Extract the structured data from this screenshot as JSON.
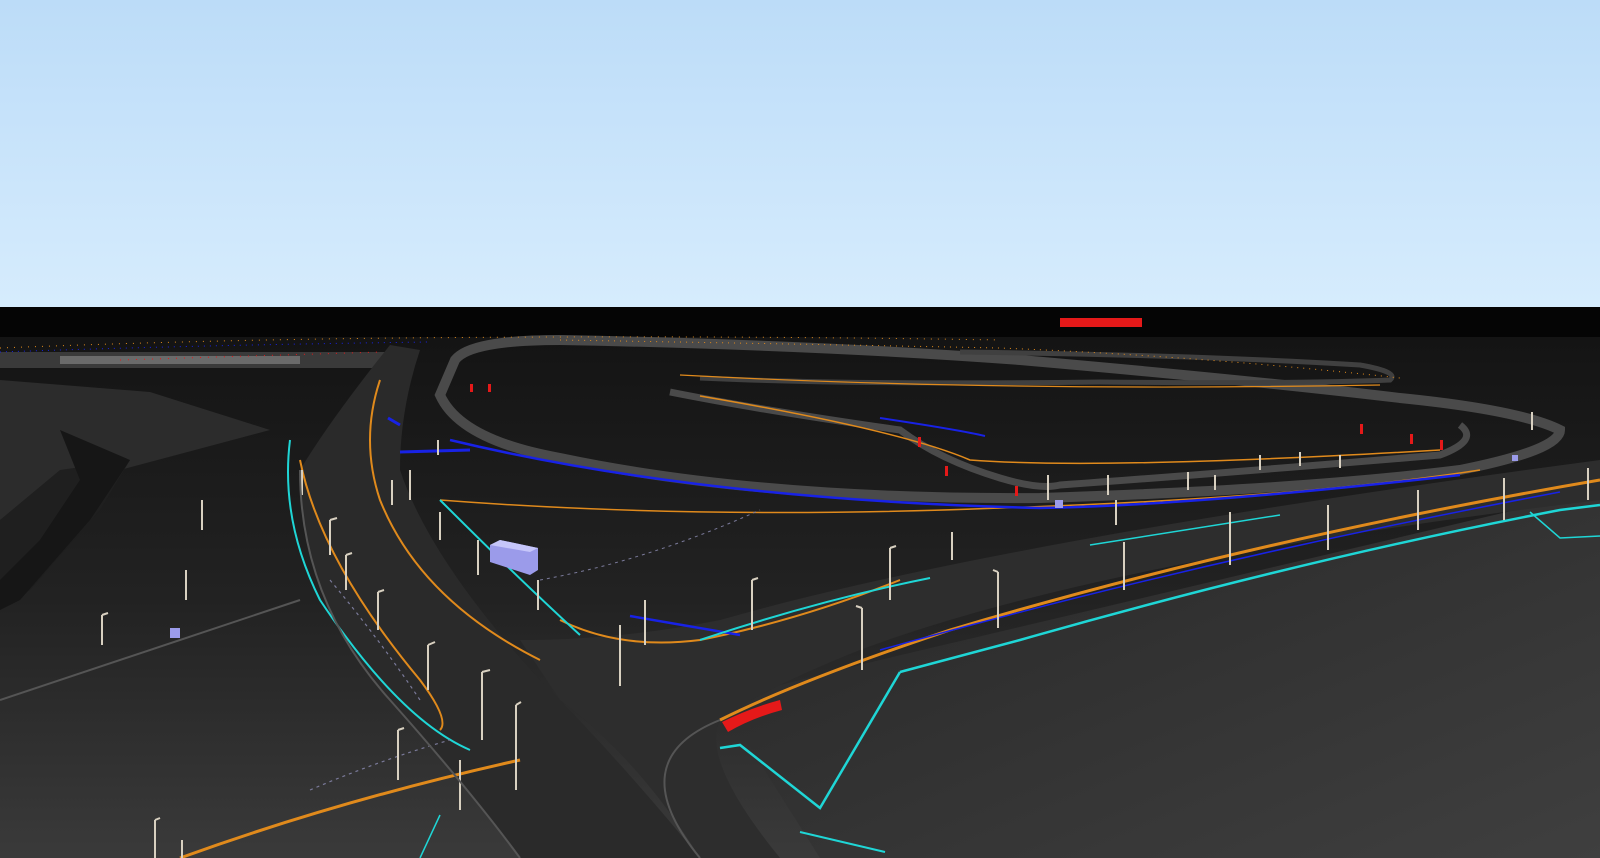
{
  "viewport": {
    "type": "3d-scene-render",
    "scene": "road-network-wireframe",
    "labels": []
  },
  "colors": {
    "sky_top": "#bcdcf8",
    "sky_bottom": "#d6ecfd",
    "horizon": "#050505",
    "ground_far": "#1a1a1a",
    "ground_near": "#3a3a3a",
    "road_surface": "#2a2a2a",
    "road_edge": "#3b3b3b",
    "lane_orange": "#e08a1c",
    "lane_blue": "#1822e6",
    "lane_cyan": "#1fd6d6",
    "marker_red": "#e51919",
    "pole_light": "#d8d0c0",
    "box_lavender": "#9b9bea",
    "curb_gray": "#5a5a5a"
  }
}
